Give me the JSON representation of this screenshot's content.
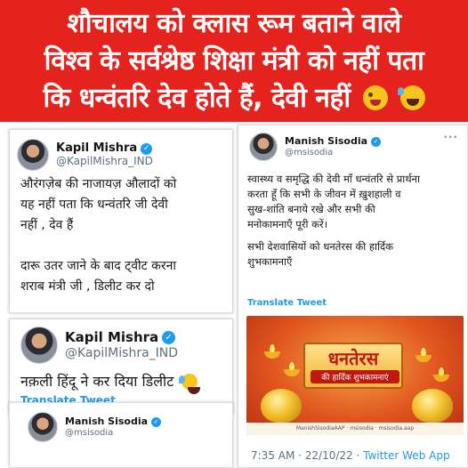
{
  "banner": {
    "line1": "शौचालय को क्लास रूम बताने वाले",
    "line2": "विश्व के सर्वश्रेष्ठ शिक्षा मंत्री को नहीं पता",
    "line3": "कि धन्वंतरि देव होते हैं, देवी नहीं",
    "emojis": [
      "winking-face-tongue-icon",
      "tears-of-joy-icon"
    ]
  },
  "tweet_kapil_1": {
    "name": "Kapil Mishra",
    "handle": "@KapilMishra_IND",
    "text_lines": [
      "औरंगज़ेब की नाजायज़ औलादों को",
      "यह नहीं पता कि धन्वंतरि जी देवी",
      "नहीं , देव हैं",
      "",
      "दारू उतर जाने के बाद ट्वीट करना",
      "शराब मंत्री जी , डिलीट कर दो"
    ]
  },
  "tweet_kapil_2": {
    "name": "Kapil Mishra",
    "handle": "@KapilMishra_IND",
    "text": "नक़ली हिंदू ने कर दिया डिलीट",
    "translate": "Translate Tweet"
  },
  "tweet_manish_small": {
    "name": "Manish Sisodia",
    "handle": "@msisodia"
  },
  "tweet_manish_main": {
    "name": "Manish Sisodia",
    "handle": "@msisodia",
    "more": "···",
    "text_lines": [
      "स्वास्थ्य व समृद्धि की देवी माँ धन्वंतरि से प्रार्थना",
      "करता हूँ कि सभी के जीवन में ख़ुशहाली व",
      "सुख-शांति बनाये रखे और सभी की",
      "मनोकामनाएँ पूरी करें।",
      "",
      "सभी देशवासियों को धनतेरस की हार्दिक",
      "शुभकामनाएँ"
    ],
    "translate": "Translate Tweet",
    "poster_title": "धनतेरस",
    "poster_subtitle": "की हार्दिक शुभकामनाएं",
    "poster_footer": "ManishSisodiaAAP · msisodia · msisodia.aap",
    "timestamp": "7:35 AM · 22/10/22 · ",
    "source": "Twitter Web App"
  },
  "colors": {
    "banner_red": "#e5231e",
    "twitter_blue": "#1d9bf0"
  }
}
